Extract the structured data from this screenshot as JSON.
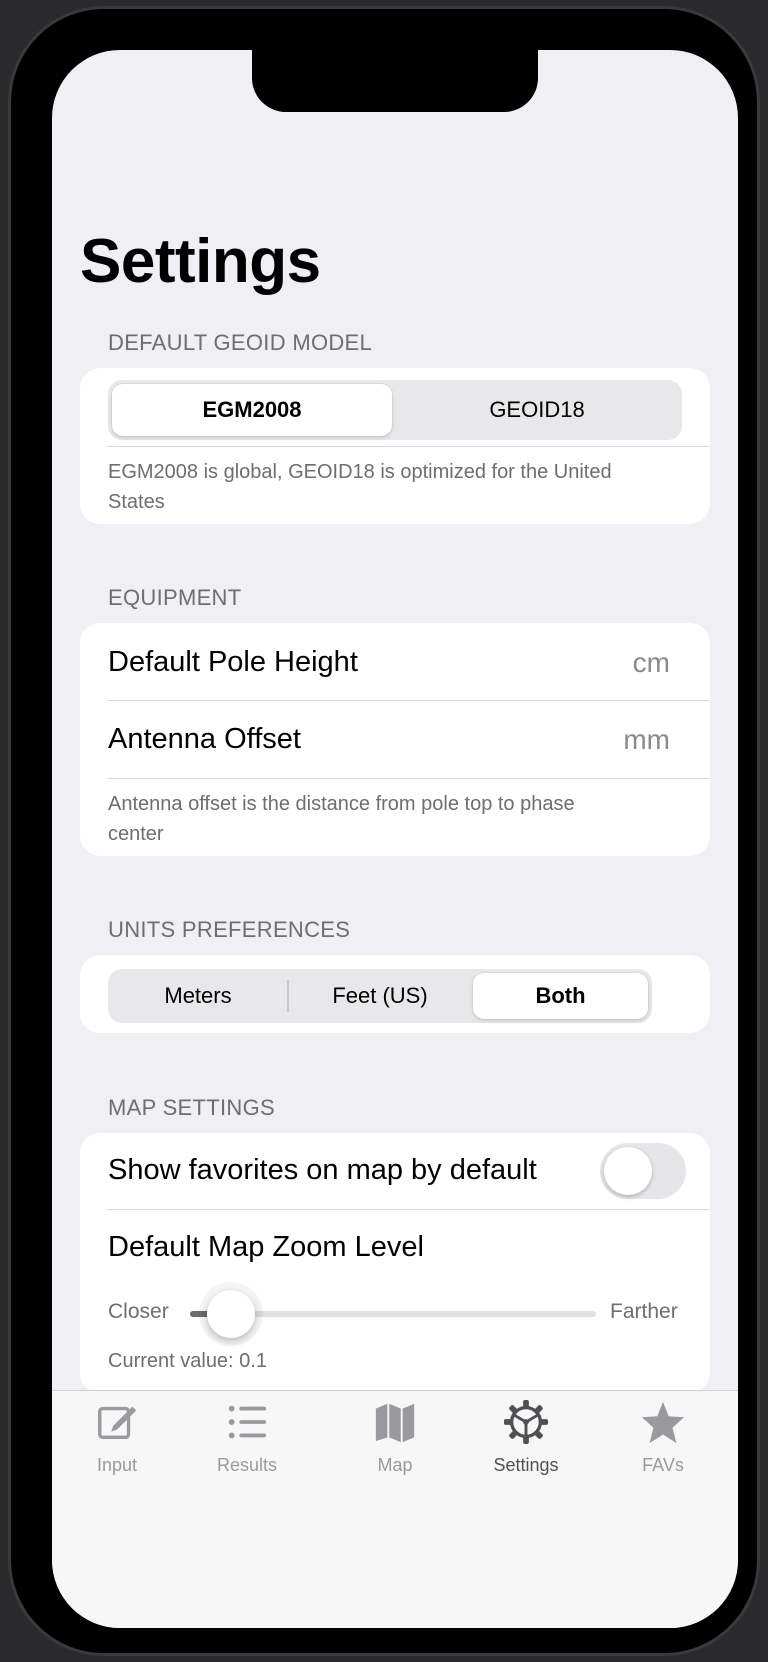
{
  "page": {
    "title": "Settings"
  },
  "geoid": {
    "header": "DEFAULT GEOID MODEL",
    "options": [
      "EGM2008",
      "GEOID18"
    ],
    "selected": "EGM2008",
    "footnote": "EGM2008 is global, GEOID18 is optimized for the United States"
  },
  "equipment": {
    "header": "EQUIPMENT",
    "pole_height": {
      "label": "Default Pole Height",
      "placeholder": "cm"
    },
    "antenna_offset": {
      "label": "Antenna Offset",
      "placeholder": "mm"
    },
    "footnote": "Antenna offset is the distance from pole top to phase center"
  },
  "units": {
    "header": "UNITS PREFERENCES",
    "options": [
      "Meters",
      "Feet (US)",
      "Both"
    ],
    "selected": "Both"
  },
  "map": {
    "header": "MAP SETTINGS",
    "favorites_toggle": {
      "label": "Show favorites on map by default",
      "on": false
    },
    "zoom": {
      "label": "Default Map Zoom Level",
      "min_label": "Closer",
      "max_label": "Farther",
      "value": 0.1,
      "current_text": "Current value: 0.1"
    }
  },
  "tabbar": {
    "tabs": [
      {
        "label": "Input",
        "icon": "edit-icon",
        "active": false
      },
      {
        "label": "Results",
        "icon": "list-icon",
        "active": false
      },
      {
        "label": "Map",
        "icon": "map-icon",
        "active": false
      },
      {
        "label": "Settings",
        "icon": "gear-icon",
        "active": true
      },
      {
        "label": "FAVs",
        "icon": "star-icon",
        "active": false
      }
    ]
  },
  "colors": {
    "background": "#f0eff4",
    "card": "#ffffff",
    "secondary_text": "#6d6d72",
    "tab_inactive": "#9a9a9e",
    "tab_active": "#505054"
  }
}
